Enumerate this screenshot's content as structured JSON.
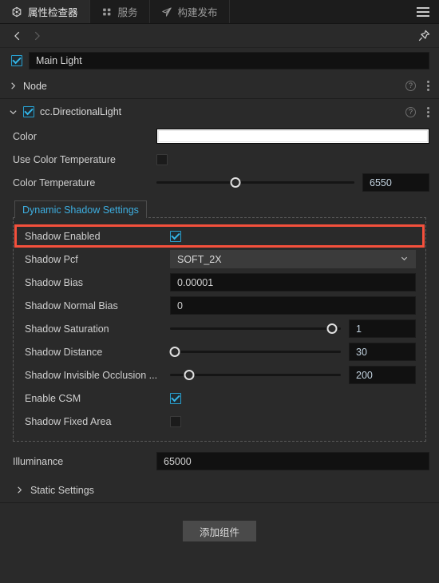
{
  "tabbar": {
    "tabs": [
      {
        "label": "属性检查器",
        "icon": "hexagon-node-icon",
        "active": true
      },
      {
        "label": "服务",
        "icon": "four-dots-icon",
        "active": false
      },
      {
        "label": "构建发布",
        "icon": "paper-plane-icon",
        "active": false
      }
    ],
    "menu_icon": "hamburger-menu-icon"
  },
  "nav": {
    "back_icon": "chevron-left-icon",
    "forward_icon": "chevron-right-icon",
    "pin_icon": "pin-icon"
  },
  "node": {
    "enabled": true,
    "name": "Main Light",
    "name_placeholder": "Name",
    "section_label": "Node",
    "help_icon": "question-circle-icon",
    "menu_icon": "kebab-menu-icon",
    "collapsed_arrow": "chevron-right-icon"
  },
  "component": {
    "label": "cc.DirectionalLight",
    "enabled": true,
    "expanded_arrow": "chevron-down-icon",
    "help_icon": "question-circle-icon",
    "menu_icon": "kebab-menu-icon"
  },
  "properties": {
    "color": {
      "label": "Color",
      "value": "#FFFFFF"
    },
    "use_color_temperature": {
      "label": "Use Color Temperature",
      "checked": false
    },
    "color_temperature": {
      "label": "Color Temperature",
      "value": "6550",
      "percent": 40
    }
  },
  "dynamic_shadow": {
    "tab_label": "Dynamic Shadow Settings",
    "tab_color": "#3daee0",
    "highlight_color": "#f4503c",
    "rows": {
      "shadow_enabled": {
        "label": "Shadow Enabled",
        "checked": true,
        "highlighted": true
      },
      "shadow_pcf": {
        "label": "Shadow Pcf",
        "value": "SOFT_2X",
        "chevron": "chevron-down-icon"
      },
      "shadow_bias": {
        "label": "Shadow Bias",
        "value": "0.00001"
      },
      "shadow_normal_bias": {
        "label": "Shadow Normal Bias",
        "value": "0"
      },
      "shadow_saturation": {
        "label": "Shadow Saturation",
        "value": "1",
        "percent": 95
      },
      "shadow_distance": {
        "label": "Shadow Distance",
        "value": "30",
        "percent": 3
      },
      "shadow_invisible_occlusion": {
        "label": "Shadow Invisible Occlusion ...",
        "value": "200",
        "percent": 11
      },
      "enable_csm": {
        "label": "Enable CSM",
        "checked": true
      },
      "shadow_fixed_area": {
        "label": "Shadow Fixed Area",
        "checked": false
      }
    }
  },
  "illuminance": {
    "label": "Illuminance",
    "value": "65000"
  },
  "static_settings": {
    "label": "Static Settings",
    "arrow": "chevron-right-icon"
  },
  "add_component": {
    "label": "添加组件"
  }
}
